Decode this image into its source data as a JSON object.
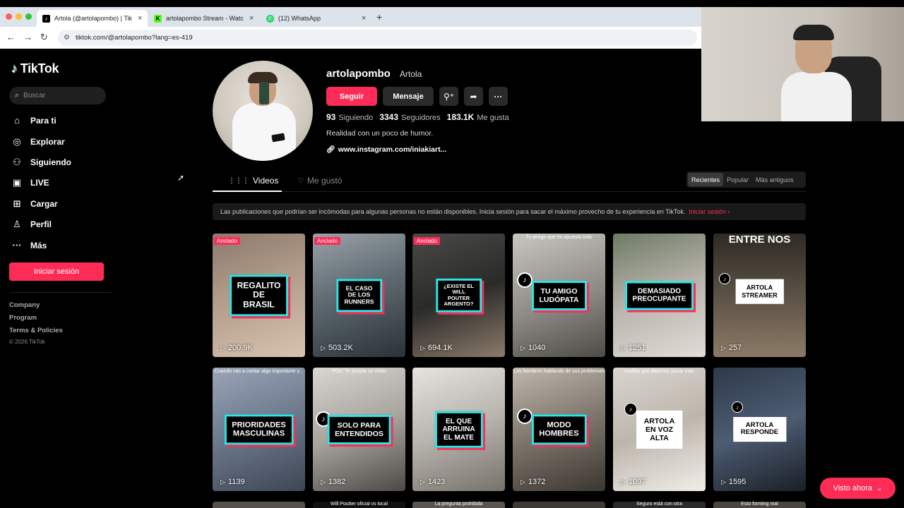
{
  "browser": {
    "tabs": [
      {
        "title": "Artola (@artolapombo) | TikTok",
        "favicon": "tiktok-icon"
      },
      {
        "title": "artolapombo Stream - Watch",
        "favicon": "kick-icon"
      },
      {
        "title": "(12) WhatsApp",
        "favicon": "whatsapp-icon"
      }
    ],
    "url": "tiktok.com/@artolapombo?lang=es-419"
  },
  "sidebar": {
    "logo": "TikTok",
    "search_placeholder": "Buscar",
    "items": [
      {
        "label": "Para ti",
        "icon": "home-icon"
      },
      {
        "label": "Explorar",
        "icon": "compass-icon"
      },
      {
        "label": "Siguiendo",
        "icon": "following-icon"
      },
      {
        "label": "LIVE",
        "icon": "live-icon"
      },
      {
        "label": "Cargar",
        "icon": "upload-icon"
      },
      {
        "label": "Perfil",
        "icon": "profile-icon"
      },
      {
        "label": "Más",
        "icon": "more-icon"
      }
    ],
    "login": "Iniciar sesión",
    "footer": [
      "Company",
      "Program",
      "Terms & Policies"
    ],
    "copyright": "© 2026 TikTok"
  },
  "profile": {
    "username": "artolapombo",
    "nickname": "Artola",
    "follow": "Seguir",
    "message": "Mensaje",
    "stats": [
      {
        "value": "93",
        "label": "Siguiendo"
      },
      {
        "value": "3343",
        "label": "Seguidores"
      },
      {
        "value": "183.1K",
        "label": "Me gusta"
      }
    ],
    "bio": "Realidad con un poco de humor.",
    "link": "www.instagram.com/iniakiart..."
  },
  "tabs": {
    "videos": "Videos",
    "liked": "Me gustó"
  },
  "sort": [
    "Recientes",
    "Popular",
    "Más antiguos"
  ],
  "notice": {
    "text": "Las publicaciones que podrían ser incómodas para algunas personas no están disponibles. Inicia sesión para sacar el máximo provecho de tu experiencia en TikTok.",
    "cta": "Iniciar sesión"
  },
  "videos": [
    {
      "caption": "REGALITO DE\nBRASIL",
      "views": "200.9K",
      "pinned": "Anclado"
    },
    {
      "caption": "EL CASO DE LOS\nRUNNERS",
      "views": "503.2K",
      "pinned": "Anclado"
    },
    {
      "caption": "¿EXISTE EL WILL\nPOUTER ARGENTO?",
      "views": "694.1K",
      "pinned": "Anclado"
    },
    {
      "caption": "TU AMIGO\nLUDÓPATA",
      "views": "1040",
      "top": "Tu amigo que es apuesta todo"
    },
    {
      "caption": "DEMASIADO\nPREOCUPANTE",
      "views": "1251"
    },
    {
      "caption": "ARTOLA STREAMER",
      "views": "257",
      "top": "ENTRE NOS"
    },
    {
      "caption": "PRIORIDADES\nMASCULINAS",
      "views": "1139",
      "top": "Cuando vas a contar algo importante y..."
    },
    {
      "caption": "SOLO PARA\nENTENDIDOS",
      "views": "1382",
      "top": "POV: Te acepta un vinito"
    },
    {
      "caption": "EL QUE ARRUINA\nEL MATE",
      "views": "1423"
    },
    {
      "caption": "MODO\nHOMBRES",
      "views": "1372",
      "top": "Los hombres hablando de sus problemas"
    },
    {
      "caption": "ARTOLA\nEN VOZ ALTA",
      "views": "1097",
      "top": "Insólito que dejemos pasar esto"
    },
    {
      "caption": "ARTOLA\nRESPONDE",
      "views": "1595"
    }
  ],
  "peek_texts": [
    "Will Poutter oficial vs local",
    "La pregunta prohibida",
    "Seguro está con otra",
    "Esto forming mal"
  ],
  "visto": "Visto ahora"
}
